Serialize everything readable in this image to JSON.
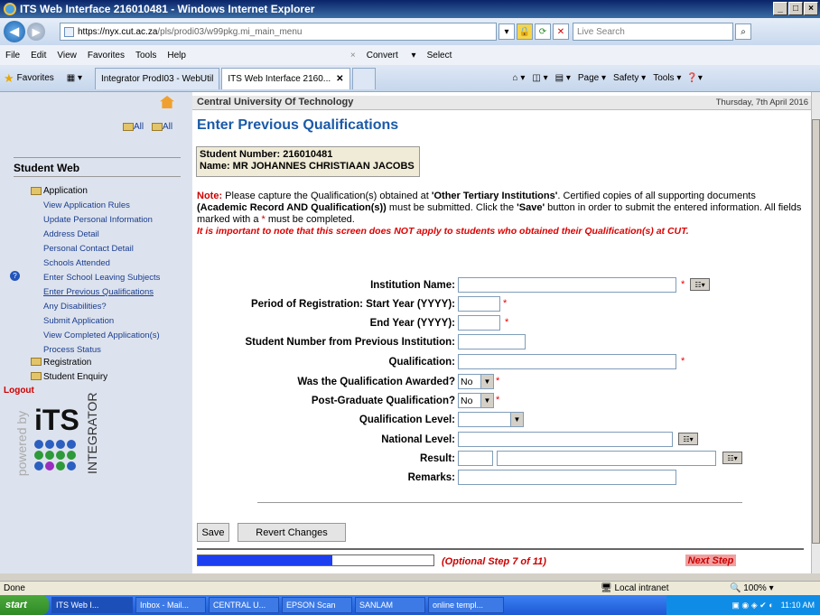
{
  "window": {
    "title": "ITS Web Interface 216010481 - Windows Internet Explorer",
    "controls": [
      "_",
      "□",
      "×"
    ]
  },
  "address": {
    "url_domain": "https://nyx.cut.ac.za",
    "url_path": "/pls/prodi03/w99pkg.mi_main_menu",
    "search_placeholder": "Live Search"
  },
  "menubar": {
    "items": [
      "File",
      "Edit",
      "View",
      "Favorites",
      "Tools",
      "Help"
    ],
    "convert": "Convert",
    "select": "Select"
  },
  "favbar": {
    "favorites": "Favorites",
    "tabs": [
      "Integrator ProdI03 - WebUtil",
      "ITS Web Interface 2160..."
    ],
    "tools": [
      "Page",
      "Safety",
      "Tools"
    ]
  },
  "sidebar": {
    "all1": "All",
    "all2": "All",
    "title": "Student Web",
    "application": "Application",
    "items": [
      "View Application Rules",
      "Update Personal Information",
      "Address Detail",
      "Personal Contact Detail",
      "Schools Attended",
      "Enter School Leaving Subjects",
      "Enter Previous Qualifications",
      "Any Disabilities?",
      "Submit Application",
      "View Completed Application(s)",
      "Process Status"
    ],
    "registration": "Registration",
    "student_enquiry": "Student Enquiry",
    "logout": "Logout",
    "powered_by": "powered by",
    "its": "iTS",
    "integrator": "INTEGRATOR"
  },
  "main": {
    "university": "Central University Of Technology",
    "date": "Thursday, 7th April 2016",
    "page_title": "Enter Previous Qualifications",
    "student_number_label": "Student Number: 216010481",
    "name_label": "Name: MR JOHANNES CHRISTIAAN JACOBS",
    "note_prefix": "Note:",
    "note_1": " Please capture the Qualification(s) obtained at ",
    "note_bold_1": "'Other Tertiary Institutions'",
    "note_2": ". Certified copies of all supporting documents ",
    "note_bold_2": "(Academic Record AND Qualification(s))",
    "note_3": " must be submitted. Click the ",
    "note_bold_3": "'Save'",
    "note_4": " button in order to submit the entered information. All fields marked with a ",
    "note_star": "*",
    "note_5": " must be completed.",
    "warning": "It is important to note that this screen does NOT apply to students who obtained their Qualification(s) at CUT."
  },
  "form": {
    "institution_name": "Institution Name:",
    "start_year": "Period of Registration: Start Year (YYYY):",
    "end_year": "End Year (YYYY):",
    "prev_student_number": "Student Number from Previous Institution:",
    "qualification": "Qualification:",
    "awarded": "Was the Qualification Awarded?",
    "awarded_value": "No",
    "postgrad": "Post-Graduate Qualification?",
    "postgrad_value": "No",
    "qual_level": "Qualification Level:",
    "national_level": "National Level:",
    "result": "Result:",
    "remarks": "Remarks:",
    "req": "*"
  },
  "buttons": {
    "save": "Save",
    "revert": "Revert Changes"
  },
  "progress": {
    "fraction": 0.57,
    "step_text": "(Optional Step 7 of 11)",
    "next_step": "Next Step"
  },
  "status": {
    "left": "Done",
    "zone": "Local intranet",
    "zoom": "100%"
  },
  "taskbar": {
    "start": "start",
    "tasks": [
      "ITS Web I...",
      "Inbox - Mail...",
      "CENTRAL U...",
      "EPSON Scan",
      "SANLAM",
      "online templ..."
    ],
    "clock": "11:10 AM"
  }
}
